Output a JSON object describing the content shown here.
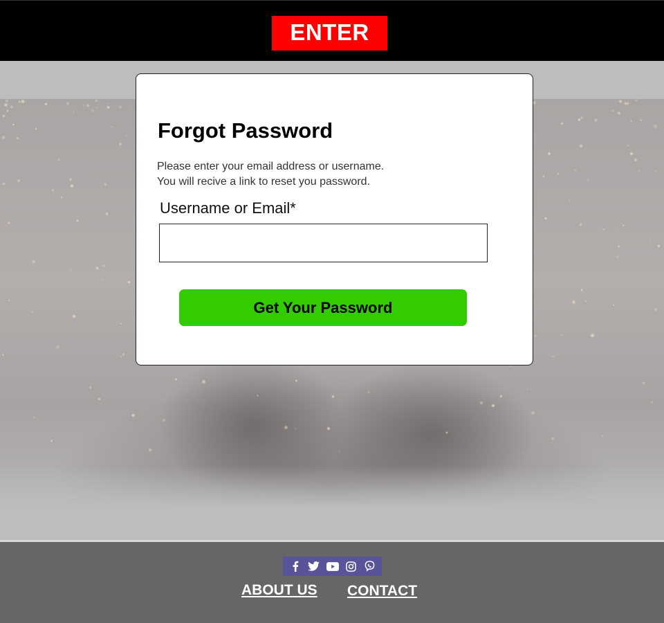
{
  "header": {
    "logo_text": "ENTER"
  },
  "form": {
    "title": "Forgot Password",
    "description_line1": "Please enter your email address or username.",
    "description_line2": "You will recive a link to reset you password.",
    "field_label": "Username or Email*",
    "field_value": "",
    "submit_label": "Get Your Password"
  },
  "footer": {
    "social_icons": [
      "facebook-icon",
      "twitter-icon",
      "youtube-icon",
      "instagram-icon",
      "viber-icon"
    ],
    "about_label": "ABOUT US",
    "contact_label": "CONTACT"
  },
  "colors": {
    "header_bg": "#000000",
    "logo_bg": "#ff0000",
    "button_bg": "#33cc00",
    "footer_bg": "#666666",
    "social_bg": "#59549a"
  }
}
